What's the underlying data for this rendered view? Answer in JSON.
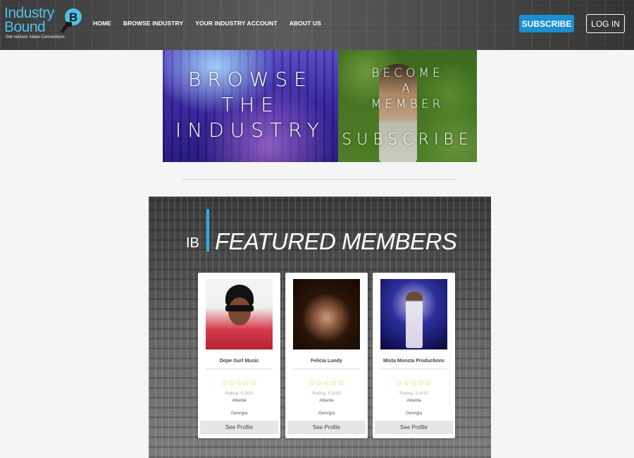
{
  "logo": {
    "line1": "Industry",
    "line2": "Bound",
    "tagline": "Get noticed. Make Connections",
    "badge_letter": "B"
  },
  "nav": {
    "items": [
      {
        "label": "HOME"
      },
      {
        "label": "BROWSE INDUSTRY"
      },
      {
        "label": "YOUR INDUSTRY ACCOUNT"
      },
      {
        "label": "ABOUT US"
      }
    ]
  },
  "header_buttons": {
    "subscribe": "SUBSCRIBE",
    "login": "LOG IN"
  },
  "banners": {
    "browse": {
      "line1": "BROWSE",
      "line2": "THE",
      "line3": "INDUSTRY"
    },
    "member": {
      "line1": "BECOME",
      "line2": "A",
      "line3": "MEMBER",
      "line4": "SUBSCRIBE"
    }
  },
  "featured": {
    "prefix": "IB",
    "title": "FEATURED MEMBERS",
    "members": [
      {
        "name": "Dope Gurl Music",
        "stars": "☆☆☆☆☆",
        "rating": "Rating: 0.0/10",
        "city": "Atlanta",
        "state": "Georgia",
        "button": "See Profile"
      },
      {
        "name": "Felicia Lundy",
        "stars": "☆☆☆☆☆",
        "rating": "Rating: 0.0/10",
        "city": "Atlanta",
        "state": "Georgia",
        "button": "See Profile"
      },
      {
        "name": "Mista Monsta Productions",
        "stars": "☆☆☆☆☆",
        "rating": "Rating: 0.0/10",
        "city": "Atlanta",
        "state": "Georgia",
        "button": "See Profile"
      }
    ]
  },
  "colors": {
    "accent": "#1b8fd0",
    "logo_blue": "#4fc0e8",
    "star": "#f2c21a"
  }
}
